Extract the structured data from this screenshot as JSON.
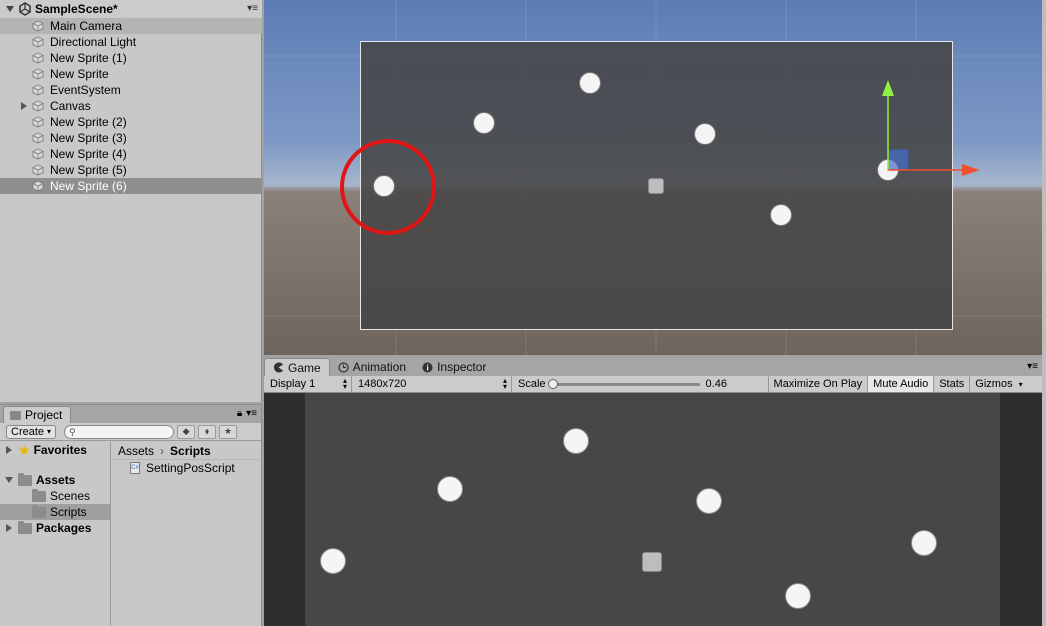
{
  "hierarchy": {
    "scene_name": "SampleScene*",
    "items": [
      {
        "label": "Main Camera",
        "state": "soft"
      },
      {
        "label": "Directional Light",
        "state": ""
      },
      {
        "label": "New Sprite (1)",
        "state": ""
      },
      {
        "label": "New Sprite",
        "state": ""
      },
      {
        "label": "EventSystem",
        "state": ""
      },
      {
        "label": "Canvas",
        "state": "",
        "expandable": true
      },
      {
        "label": "New Sprite (2)",
        "state": ""
      },
      {
        "label": "New Sprite (3)",
        "state": ""
      },
      {
        "label": "New Sprite (4)",
        "state": ""
      },
      {
        "label": "New Sprite (5)",
        "state": ""
      },
      {
        "label": "New Sprite (6)",
        "state": "selected"
      }
    ]
  },
  "game_panel": {
    "tabs": [
      {
        "label": "Game",
        "icon": "pacman-icon",
        "active": true
      },
      {
        "label": "Animation",
        "icon": "clock-icon",
        "active": false
      },
      {
        "label": "Inspector",
        "icon": "info-icon",
        "active": false
      }
    ],
    "toolbar": {
      "display": "Display 1",
      "resolution": "1480x720",
      "scale_label": "Scale",
      "scale_value": "0.46",
      "maximize": "Maximize On Play",
      "mute": "Mute Audio",
      "stats": "Stats",
      "gizmos": "Gizmos"
    }
  },
  "project": {
    "tab_label": "Project",
    "create_label": "Create",
    "search_placeholder": "",
    "tree": {
      "favorites": "Favorites",
      "assets": "Assets",
      "scenes": "Scenes",
      "scripts": "Scripts",
      "packages": "Packages"
    },
    "breadcrumb": {
      "root": "Assets",
      "current": "Scripts"
    },
    "files": [
      {
        "name": "SettingPosScript",
        "type": "cs"
      }
    ]
  },
  "colors": {
    "annotation_ring": "#e01515",
    "selection": "#8f8f8f",
    "panel_bg": "#c8c8c8"
  }
}
